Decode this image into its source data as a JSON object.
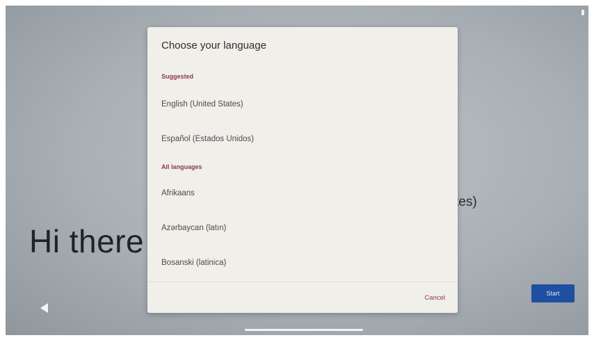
{
  "background": {
    "greeting": "Hi there",
    "language_partial": "tes)",
    "start_label": "Start",
    "start_color": "#1f4fa0"
  },
  "dialog": {
    "title": "Choose your language",
    "suggested_label": "Suggested",
    "suggested": [
      "English (United States)",
      "Español (Estados Unidos)"
    ],
    "all_label": "All languages",
    "all": [
      "Afrikaans",
      "Azərbaycan (latın)",
      "Bosanski (latinica)"
    ],
    "cancel_label": "Cancel",
    "accent_color": "#8c3a44"
  },
  "nav": {
    "back_icon": "back-triangle-icon"
  }
}
